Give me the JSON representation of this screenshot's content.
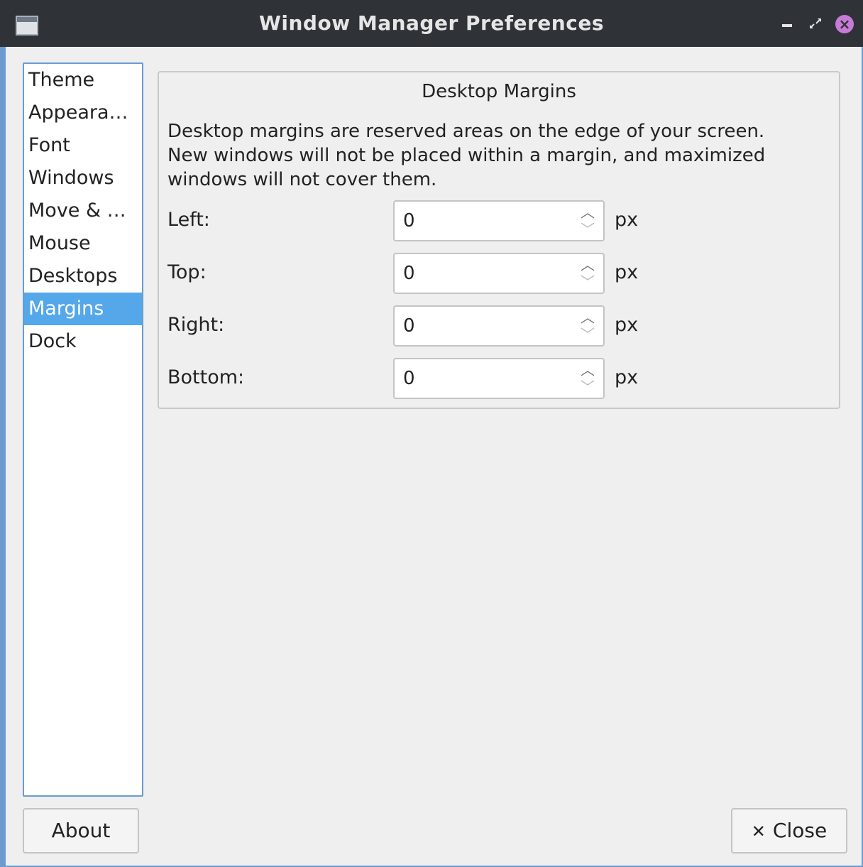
{
  "window": {
    "title": "Window Manager Preferences"
  },
  "sidebar": {
    "items": [
      {
        "label": "Theme",
        "selected": false
      },
      {
        "label": "Appeara…",
        "selected": false
      },
      {
        "label": "Font",
        "selected": false
      },
      {
        "label": "Windows",
        "selected": false
      },
      {
        "label": "Move & …",
        "selected": false
      },
      {
        "label": "Mouse",
        "selected": false
      },
      {
        "label": "Desktops",
        "selected": false
      },
      {
        "label": "Margins",
        "selected": true
      },
      {
        "label": "Dock",
        "selected": false
      }
    ]
  },
  "margins": {
    "group_title": "Desktop Margins",
    "description_lines": [
      "Desktop margins are reserved areas on the edge of your screen.",
      "New windows will not be placed within a margin, and maximized",
      "windows will not cover them."
    ],
    "fields": [
      {
        "label": "Left:",
        "value": "0",
        "unit": "px"
      },
      {
        "label": "Top:",
        "value": "0",
        "unit": "px"
      },
      {
        "label": "Right:",
        "value": "0",
        "unit": "px"
      },
      {
        "label": "Bottom:",
        "value": "0",
        "unit": "px"
      }
    ]
  },
  "footer": {
    "about_label": "About",
    "close_label": "Close"
  },
  "colors": {
    "titlebar": "#2f3237",
    "accent": "#54a7e9",
    "close_button": "#c77bd6"
  }
}
